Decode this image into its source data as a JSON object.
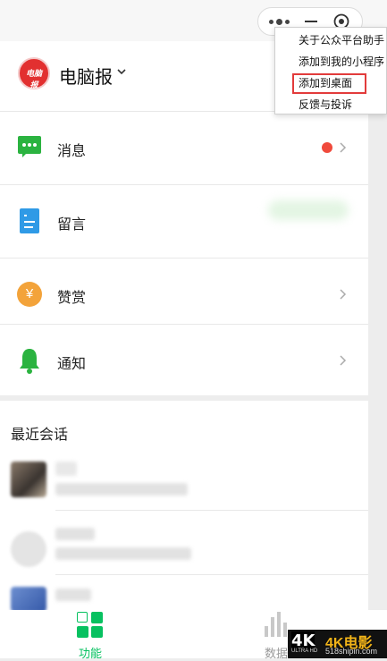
{
  "account": {
    "name": "电脑报",
    "logo_text": "电脑报"
  },
  "dropdown_menu": {
    "items": [
      {
        "label": "关于公众平台助手"
      },
      {
        "label": "添加到我的小程序"
      },
      {
        "label": "添加到桌面",
        "highlighted": true
      },
      {
        "label": "反馈与投诉"
      }
    ]
  },
  "function_list": [
    {
      "label": "消息",
      "icon": "message-icon",
      "unread": true
    },
    {
      "label": "留言",
      "icon": "comment-icon"
    },
    {
      "label": "赞赏",
      "icon": "reward-icon",
      "icon_text": "¥"
    },
    {
      "label": "通知",
      "icon": "bell-icon"
    }
  ],
  "recent_sessions": {
    "title": "最近会话"
  },
  "tabbar": {
    "tabs": [
      {
        "label": "功能",
        "active": true
      },
      {
        "label": "数据",
        "active": false
      }
    ]
  },
  "watermark": {
    "badge": "4K",
    "badge_sub": "ULTRA HD",
    "brand": "4K电影",
    "url": "518shipin.com"
  },
  "colors": {
    "accent_green": "#07c160",
    "highlight_red": "#e23b3b",
    "unread_dot": "#f04a3c"
  }
}
